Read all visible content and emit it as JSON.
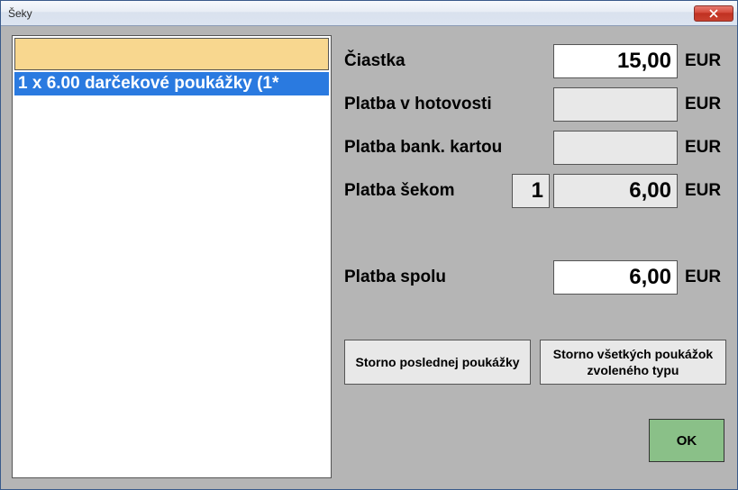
{
  "window": {
    "title": "Šeky"
  },
  "list": {
    "items": [
      {
        "text": "1 x 6.00   darčekové poukážky (1*"
      }
    ]
  },
  "fields": {
    "amount": {
      "label": "Čiastka",
      "value": "15,00",
      "currency": "EUR"
    },
    "cash": {
      "label": "Platba v hotovosti",
      "value": "",
      "currency": "EUR"
    },
    "card": {
      "label": "Platba bank. kartou",
      "value": "",
      "currency": "EUR"
    },
    "cheque": {
      "label": "Platba šekom",
      "count": "1",
      "value": "6,00",
      "currency": "EUR"
    },
    "total": {
      "label": "Platba spolu",
      "value": "6,00",
      "currency": "EUR"
    }
  },
  "buttons": {
    "storno_last": "Storno poslednej poukážky",
    "storno_all": "Storno všetkých poukážok zvoleného typu",
    "ok": "OK"
  }
}
